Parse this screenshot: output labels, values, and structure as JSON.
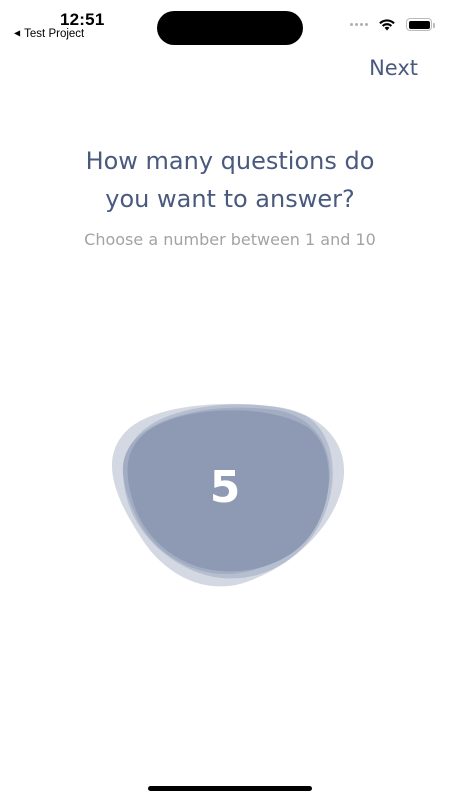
{
  "status_bar": {
    "time": "12:51",
    "back_app": "Test Project",
    "back_icon": "back-triangle-icon"
  },
  "nav": {
    "next_label": "Next"
  },
  "prompt": {
    "title_line1": "How many questions do",
    "title_line2": "you want to answer?",
    "subtitle": "Choose a number between 1 and 10"
  },
  "selector": {
    "value": "5",
    "min": 1,
    "max": 10
  },
  "colors": {
    "accent": "#4a5a7e",
    "blob": "#8e9ab4",
    "subtitle": "#a3a3a3"
  }
}
